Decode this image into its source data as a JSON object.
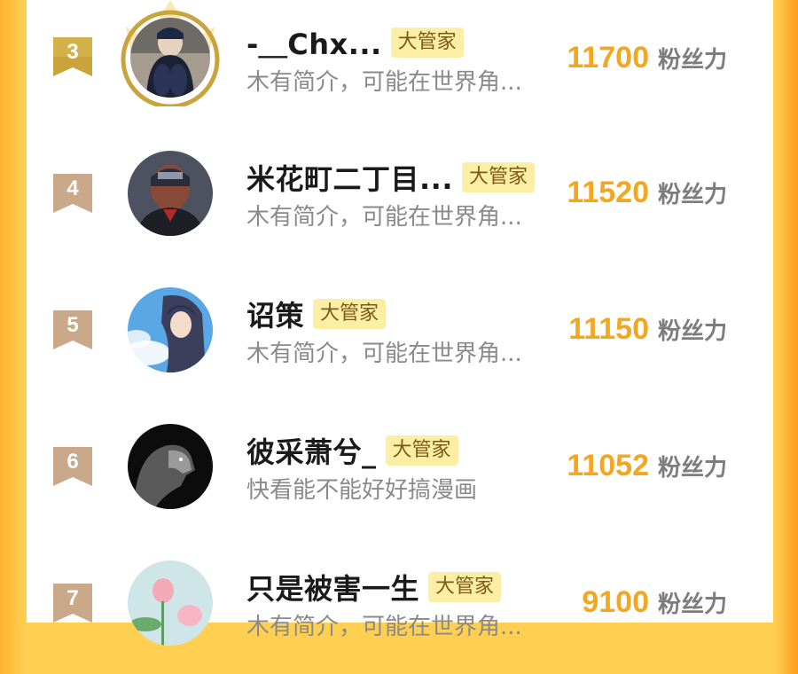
{
  "tag_label": "大管家",
  "score_unit": "粉丝力",
  "colors": {
    "accent": "#f3a620",
    "tag_bg": "#fdeea5",
    "rank_top": "#c9a33b",
    "rank_other": "#c9a98a"
  },
  "rows": [
    {
      "rank": "3",
      "name": "-＿Chx...",
      "bio": "木有简介，可能在世界角...",
      "score": "11700",
      "avatar_icon": "user-photo-avatar"
    },
    {
      "rank": "4",
      "name": "米花町二丁目...",
      "bio": "木有简介，可能在世界角...",
      "score": "11520",
      "avatar_icon": "anime-character-avatar"
    },
    {
      "rank": "5",
      "name": "诏策",
      "bio": "木有简介，可能在世界角...",
      "score": "11150",
      "avatar_icon": "anime-girl-sky-avatar"
    },
    {
      "rank": "6",
      "name": "彼采萧兮_",
      "bio": "快看能不能好好搞漫画",
      "score": "11052",
      "avatar_icon": "lion-avatar"
    },
    {
      "rank": "7",
      "name": "只是被害一生",
      "bio": "木有简介，可能在世界角...",
      "score": "9100",
      "avatar_icon": "lotus-flower-avatar"
    }
  ]
}
